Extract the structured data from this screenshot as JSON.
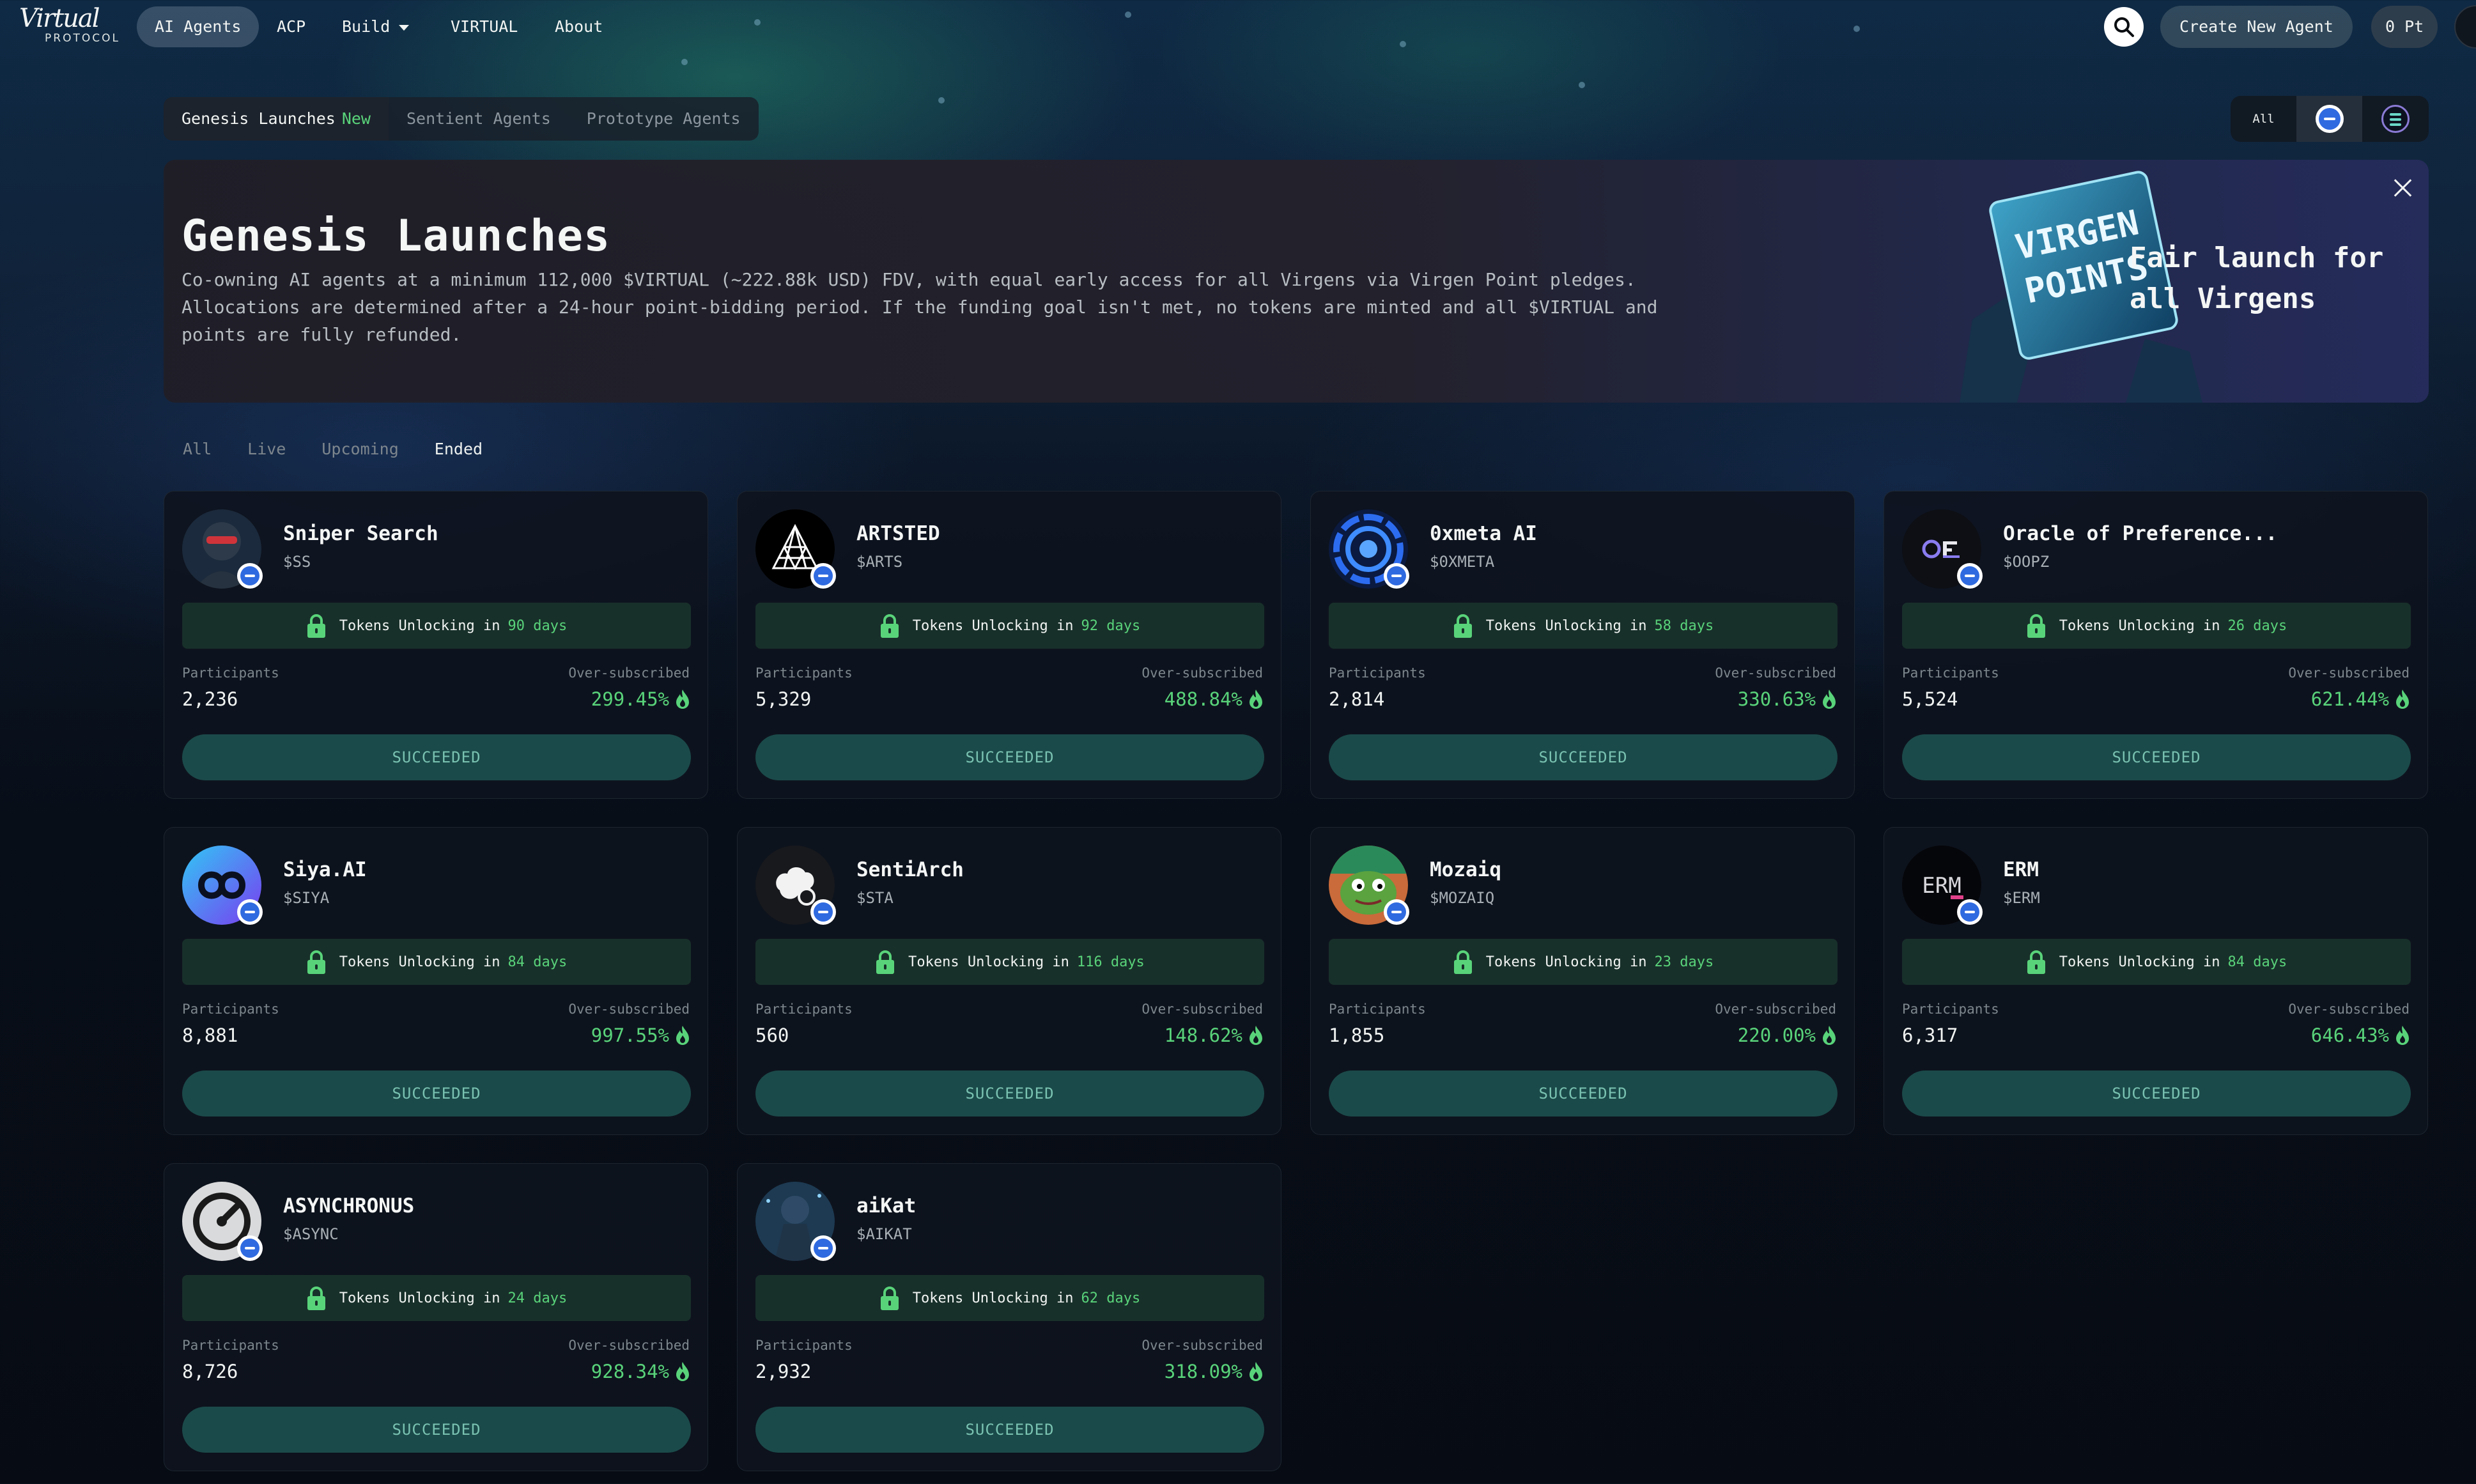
{
  "nav": {
    "logo_script": "Virtual",
    "logo_sub": "PROTOCOL",
    "items": [
      {
        "label": "AI Agents"
      },
      {
        "label": "ACP"
      },
      {
        "label": "Build"
      },
      {
        "label": "VIRTUAL"
      },
      {
        "label": "About"
      }
    ],
    "create_label": "Create New Agent",
    "points_label": "0 Pt"
  },
  "tabs": [
    {
      "label": "Genesis Launches",
      "badge": "New"
    },
    {
      "label": "Sentient Agents"
    },
    {
      "label": "Prototype Agents"
    }
  ],
  "chain_filter": {
    "all_label": "All"
  },
  "banner": {
    "title": "Genesis Launches",
    "description": "Co-owning AI agents at a minimum 112,000 $VIRTUAL (~222.88k USD) FDV, with equal early access for all Virgens via Virgen Point pledges. Allocations are determined after a 24-hour point-bidding period. If the funding goal isn't met, no tokens are minted and all $VIRTUAL and points are fully refunded.",
    "art_text_1": "VIRGEN",
    "art_text_2": "POINTS",
    "slogan": "Fair launch for all Virgens"
  },
  "filters": [
    {
      "label": "All"
    },
    {
      "label": "Live"
    },
    {
      "label": "Upcoming"
    },
    {
      "label": "Ended"
    }
  ],
  "card_labels": {
    "unlock_prefix": "Tokens Unlocking in",
    "participants": "Participants",
    "oversubscribed": "Over-subscribed"
  },
  "cards": [
    {
      "name": "Sniper Search",
      "ticker": "$SS",
      "days": "90 days",
      "participants": "2,236",
      "oversubscribed": "299.45%",
      "status": "SUCCEEDED",
      "avatar": "soldier-avatar"
    },
    {
      "name": "ARTSTED",
      "ticker": "$ARTS",
      "days": "92 days",
      "participants": "5,329",
      "oversubscribed": "488.84%",
      "status": "SUCCEEDED",
      "avatar": "triangle-logo"
    },
    {
      "name": "0xmeta AI",
      "ticker": "$0XMETA",
      "days": "58 days",
      "participants": "2,814",
      "oversubscribed": "330.63%",
      "status": "SUCCEEDED",
      "avatar": "blue-ring-logo"
    },
    {
      "name": "Oracle of Preference...",
      "ticker": "$OOPZ",
      "days": "26 days",
      "participants": "5,524",
      "oversubscribed": "621.44%",
      "status": "SUCCEEDED",
      "avatar": "oracle-logo"
    },
    {
      "name": "Siya.AI",
      "ticker": "$SIYA",
      "days": "84 days",
      "participants": "8,881",
      "oversubscribed": "997.55%",
      "status": "SUCCEEDED",
      "avatar": "infinity-logo"
    },
    {
      "name": "SentiArch",
      "ticker": "$STA",
      "days": "116 days",
      "participants": "560",
      "oversubscribed": "148.62%",
      "status": "SUCCEEDED",
      "avatar": "brain-logo"
    },
    {
      "name": "Mozaiq",
      "ticker": "$MOZAIQ",
      "days": "23 days",
      "participants": "1,855",
      "oversubscribed": "220.00%",
      "status": "SUCCEEDED",
      "avatar": "frog-avatar"
    },
    {
      "name": "ERM",
      "ticker": "$ERM",
      "days": "84 days",
      "participants": "6,317",
      "oversubscribed": "646.43%",
      "status": "SUCCEEDED",
      "avatar": "erm-logo"
    },
    {
      "name": "ASYNCHRONUS",
      "ticker": "$ASYNC",
      "days": "24 days",
      "participants": "8,726",
      "oversubscribed": "928.34%",
      "status": "SUCCEEDED",
      "avatar": "async-logo"
    },
    {
      "name": "aiKat",
      "ticker": "$AIKAT",
      "days": "62 days",
      "participants": "2,932",
      "oversubscribed": "318.09%",
      "status": "SUCCEEDED",
      "avatar": "aikat-avatar"
    }
  ],
  "colors": {
    "accent_green": "#59d37a",
    "status_button": "#1b4a4a",
    "unlock_bg": "#18302a"
  }
}
